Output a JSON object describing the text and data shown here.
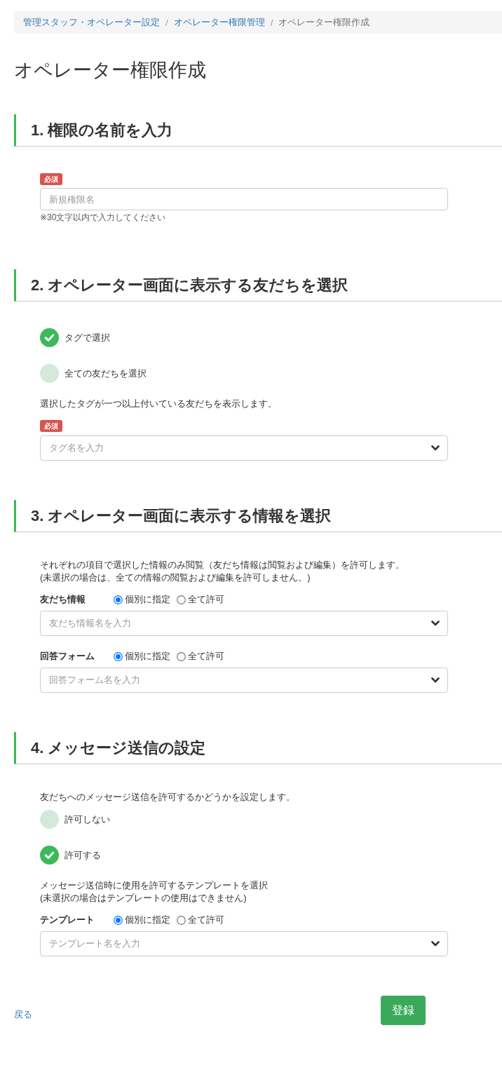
{
  "breadcrumb": {
    "separator": "/",
    "items": [
      {
        "label": "管理スタッフ・オペレーター設定",
        "kind": "link"
      },
      {
        "label": "オペレーター権限管理",
        "kind": "link"
      },
      {
        "label": "オペレーター権限作成",
        "kind": "current"
      }
    ]
  },
  "title": "オペレーター権限作成",
  "sections": [
    {
      "heading": "1. 権限の名前を入力",
      "blocks": [
        {
          "kind": "input",
          "badge": "必須",
          "placeholder": "新規権限名",
          "hint": "※30文字以内で入力してください"
        }
      ]
    },
    {
      "heading": "2. オペレーター画面に表示する友だちを選択",
      "blocks": [
        {
          "kind": "choices",
          "options": [
            {
              "label": "タグで選択",
              "selected": true
            },
            {
              "label": "全ての友だちを選択",
              "selected": false
            }
          ]
        },
        {
          "kind": "text",
          "lines": [
            "選択したタグが一つ以上付いている友だちを表示します。"
          ]
        },
        {
          "kind": "select",
          "badge": "必須",
          "placeholder": "タグ名を入力"
        }
      ]
    },
    {
      "heading": "3. オペレーター画面に表示する情報を選択",
      "blocks": [
        {
          "kind": "text",
          "lines": [
            "それぞれの項目で選択した情報のみ閲覧（友だち情報は閲覧および編集）を許可します。",
            "(未選択の場合は、全ての情報の閲覧および編集を許可しません。)"
          ]
        },
        {
          "kind": "scoped_select",
          "label": "友だち情報",
          "options": [
            {
              "label": "個別に指定",
              "selected": true
            },
            {
              "label": "全て許可",
              "selected": false
            }
          ],
          "placeholder": "友だち情報名を入力"
        },
        {
          "kind": "scoped_select",
          "label": "回答フォーム",
          "options": [
            {
              "label": "個別に指定",
              "selected": true
            },
            {
              "label": "全て許可",
              "selected": false
            }
          ],
          "placeholder": "回答フォーム名を入力"
        }
      ]
    },
    {
      "heading": "4. メッセージ送信の設定",
      "blocks": [
        {
          "kind": "text",
          "lines": [
            "友だちへのメッセージ送信を許可するかどうかを設定します。"
          ]
        },
        {
          "kind": "choices",
          "options": [
            {
              "label": "許可しない",
              "selected": false
            },
            {
              "label": "許可する",
              "selected": true
            }
          ]
        },
        {
          "kind": "text",
          "lines": [
            "メッセージ送信時に使用を許可するテンプレートを選択",
            "(未選択の場合はテンプレートの使用はできません)"
          ]
        },
        {
          "kind": "scoped_select",
          "label": "テンプレート",
          "options": [
            {
              "label": "個別に指定",
              "selected": true
            },
            {
              "label": "全て許可",
              "selected": false
            }
          ],
          "placeholder": "テンプレート名を入力"
        }
      ]
    }
  ],
  "footer": {
    "back_link": "戻る",
    "submit_button": "登録"
  }
}
